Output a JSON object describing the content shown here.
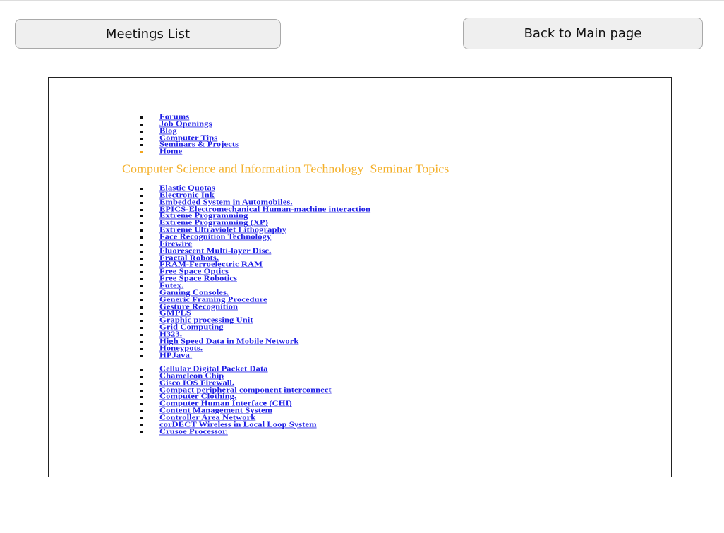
{
  "toolbar": {
    "meetings_label": "Meetings List",
    "back_label": "Back to Main page"
  },
  "frame": {
    "nav_links": [
      "Forums",
      "Job Openings",
      "Blog",
      "Computer Tips",
      "Seminars & Projects",
      "Home"
    ],
    "heading": "Computer Science and Information Technology  Seminar Topics",
    "topics_a": [
      "Elastic Quotas",
      "Electronic Ink",
      "Embedded System in Automobiles.",
      "EPICS-Electromechanical Human-machine interaction",
      "Extreme Programming",
      "Extreme Programming (XP)",
      "Extreme Ultraviolet Lithography",
      "Face Recognition Technology",
      "Firewire",
      "Fluorescent Multi-layer Disc.",
      "Fractal Robots.",
      "FRAM-Ferroelectric RAM",
      "Free Space Optics",
      "Free Space Robotics",
      "Futex.",
      "Gaming Consoles.",
      "Generic Framing Procedure",
      "Gesture Recognition",
      "GMPLS",
      "Graphic processing Unit",
      "Grid Computing",
      "H323.",
      "High Speed Data in Mobile Network",
      "Honeypots.",
      "HPJava."
    ],
    "topics_b": [
      "Cellular Digital Packet Data",
      "Chameleon Chip",
      "Cisco IOS Firewall.",
      "Compact peripheral component interconnect",
      "Computer Clothing.",
      "Computer Human Interface (CHI)",
      "Content Management System",
      "Controller Area Network",
      "corDECT Wireless in Local Loop System",
      "Crusoe Processor."
    ]
  },
  "colors": {
    "heading": "#f4b02a",
    "link": "#1e1ee6",
    "button_bg": "#efefef"
  }
}
